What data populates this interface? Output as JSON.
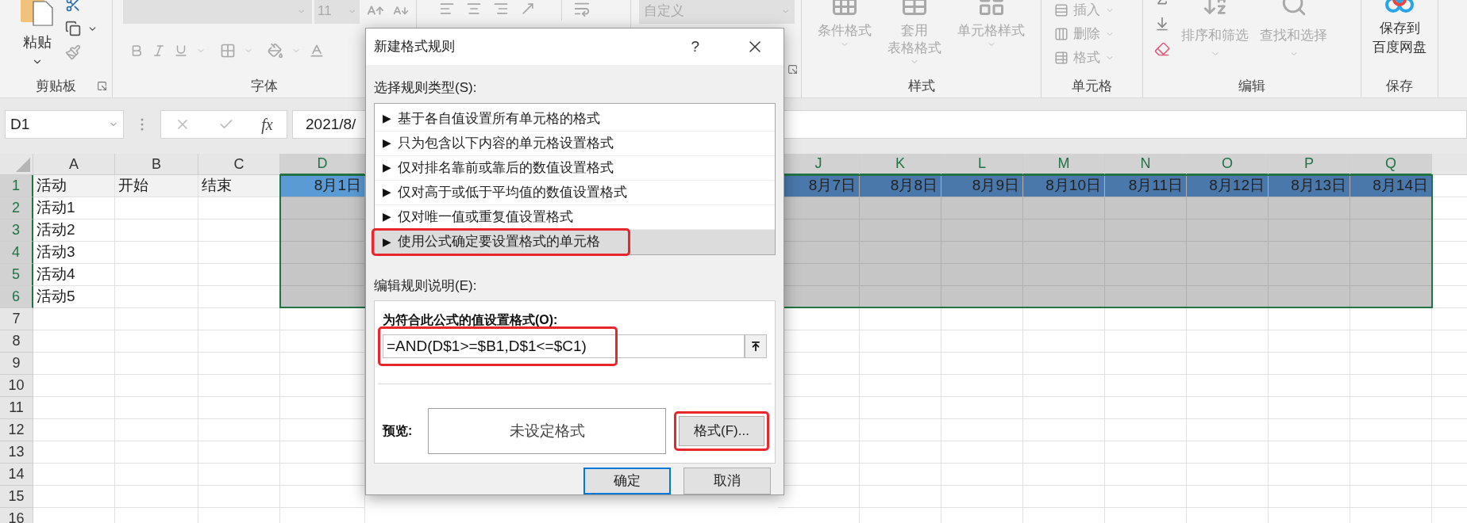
{
  "ribbon": {
    "clipboard": {
      "label": "剪贴板",
      "paste": "粘贴"
    },
    "font": {
      "label": "字体",
      "size": "11"
    },
    "number": {
      "format": "自定义"
    },
    "styles": {
      "label": "样式",
      "commands": [
        {
          "lines": [
            "条件格式"
          ]
        },
        {
          "lines": [
            "套用",
            "表格格式"
          ]
        },
        {
          "lines": [
            "单元格样式"
          ]
        }
      ]
    },
    "cells": {
      "label": "单元格",
      "commands": [
        "插入",
        "删除",
        "格式"
      ]
    },
    "editing": {
      "label": "编辑",
      "commands": [
        "排序和筛选",
        "查找和选择"
      ]
    },
    "save": {
      "label": "保存",
      "lines": [
        "保存到",
        "百度网盘"
      ]
    }
  },
  "formula_bar": {
    "name_box": "D1",
    "function_button": "fx",
    "formula": "2021/8/"
  },
  "sheet": {
    "columns": [
      {
        "label": "A",
        "selected": false
      },
      {
        "label": "B",
        "selected": false
      },
      {
        "label": "C",
        "selected": false
      },
      {
        "label": "D",
        "selected": true
      },
      {
        "label": "J",
        "selected": true
      },
      {
        "label": "K",
        "selected": true
      },
      {
        "label": "L",
        "selected": true
      },
      {
        "label": "M",
        "selected": true
      },
      {
        "label": "N",
        "selected": true
      },
      {
        "label": "O",
        "selected": true
      },
      {
        "label": "P",
        "selected": true
      },
      {
        "label": "Q",
        "selected": true
      }
    ],
    "rows": [
      {
        "label": "1",
        "selected": true,
        "filled": true,
        "cells": [
          {
            "text": "活动",
            "active": false
          },
          {
            "text": "开始",
            "active": false
          },
          {
            "text": "结束",
            "active": false
          },
          {
            "text": "8月1日",
            "active": true
          },
          {
            "text": "8月7日",
            "active": false
          },
          {
            "text": "8月8日",
            "active": false
          },
          {
            "text": "8月9日",
            "active": false
          },
          {
            "text": "8月10日",
            "active": false
          },
          {
            "text": "8月11日",
            "active": false
          },
          {
            "text": "8月12日",
            "active": false
          },
          {
            "text": "8月13日",
            "active": false
          },
          {
            "text": "8月14日",
            "active": false
          }
        ]
      },
      {
        "label": "2",
        "selected": true,
        "filled": false,
        "cells": [
          {
            "text": "活动1",
            "active": false
          }
        ]
      },
      {
        "label": "3",
        "selected": true,
        "filled": false,
        "cells": [
          {
            "text": "活动2",
            "active": false
          }
        ]
      },
      {
        "label": "4",
        "selected": true,
        "filled": false,
        "cells": [
          {
            "text": "活动3",
            "active": false
          }
        ]
      },
      {
        "label": "5",
        "selected": true,
        "filled": false,
        "cells": [
          {
            "text": "活动4",
            "active": false
          }
        ]
      },
      {
        "label": "6",
        "selected": true,
        "filled": false,
        "cells": [
          {
            "text": "活动5",
            "active": false
          }
        ]
      },
      {
        "label": "7",
        "selected": false,
        "filled": false
      },
      {
        "label": "8",
        "selected": false,
        "filled": false
      },
      {
        "label": "9",
        "selected": false,
        "filled": false
      },
      {
        "label": "10",
        "selected": false,
        "filled": false
      },
      {
        "label": "11",
        "selected": false,
        "filled": false
      },
      {
        "label": "12",
        "selected": false,
        "filled": false
      },
      {
        "label": "13",
        "selected": false,
        "filled": false
      },
      {
        "label": "14",
        "selected": false,
        "filled": false
      },
      {
        "label": "15",
        "selected": false,
        "filled": false
      },
      {
        "label": "16",
        "selected": false,
        "filled": false
      }
    ]
  },
  "dialog": {
    "title": "新建格式规则",
    "help": "?",
    "rule_type_label": "选择规则类型(S):",
    "rule_types": [
      {
        "bullet": "▶",
        "label": "基于各自值设置所有单元格的格式",
        "selected": false,
        "highlighted": false
      },
      {
        "bullet": "▶",
        "label": "只为包含以下内容的单元格设置格式",
        "selected": false,
        "highlighted": false
      },
      {
        "bullet": "▶",
        "label": "仅对排名靠前或靠后的数值设置格式",
        "selected": false,
        "highlighted": false
      },
      {
        "bullet": "▶",
        "label": "仅对高于或低于平均值的数值设置格式",
        "selected": false,
        "highlighted": false
      },
      {
        "bullet": "▶",
        "label": "仅对唯一值或重复值设置格式",
        "selected": false,
        "highlighted": false
      },
      {
        "bullet": "▶",
        "label": "使用公式确定要设置格式的单元格",
        "selected": true,
        "highlighted": true
      }
    ],
    "description_label": "编辑规则说明(E):",
    "formula_label": "为符合此公式的值设置格式(O):",
    "formula": {
      "value": "=AND(D$1>=$B1,D$1<=$C1)",
      "highlighted": true
    },
    "preview_label": "预览:",
    "preview_text": "未设定格式",
    "format_button": {
      "label": "格式(F)...",
      "highlighted": true
    },
    "buttons": [
      {
        "label": "确定",
        "default": true
      },
      {
        "label": "取消",
        "default": false
      }
    ]
  }
}
